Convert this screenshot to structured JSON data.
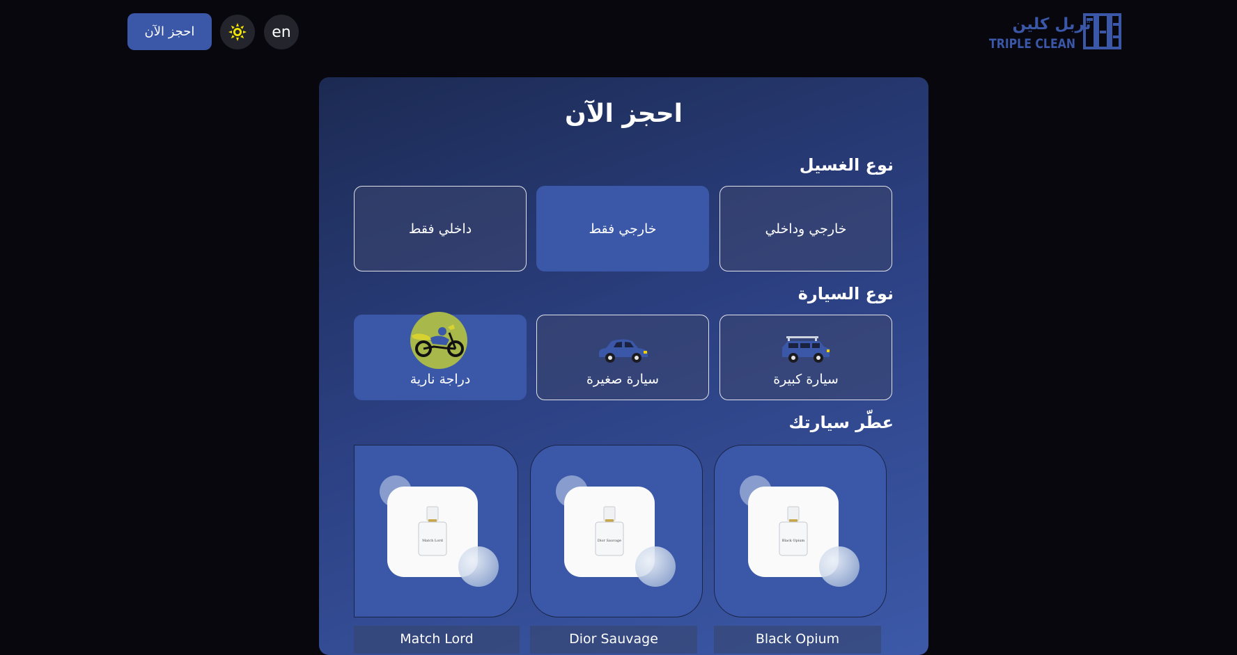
{
  "header": {
    "book_button": "احجز الآن",
    "theme_icon": "sun-icon",
    "language_button": "en",
    "logo": {
      "arabic_text": "تربل كلين",
      "latin_text": "TRIPLE CLEAN",
      "brand_color": "#3a57a8"
    }
  },
  "form": {
    "title": "احجز الآن",
    "wash_section": {
      "title": "نوع الغسيل",
      "options": [
        {
          "label": "خارجي وداخلي",
          "selected": false
        },
        {
          "label": "خارجي فقط",
          "selected": true
        },
        {
          "label": "داخلي فقط",
          "selected": false
        }
      ]
    },
    "vehicle_section": {
      "title": "نوع السيارة",
      "options": [
        {
          "label": "سيارة كبيرة",
          "icon": "suv-icon",
          "selected": false
        },
        {
          "label": "سيارة صغيرة",
          "icon": "small-car-icon",
          "selected": false
        },
        {
          "label": "دراجة نارية",
          "icon": "motorcycle-icon",
          "selected": true
        }
      ]
    },
    "perfume_section": {
      "title": "عطّر سيارتك",
      "items": [
        {
          "name": "Black Opium",
          "bottle_label": "Black Opium"
        },
        {
          "name": "Dior Sauvage",
          "bottle_label": "Dior Sauvage"
        },
        {
          "name": "Match Lord",
          "bottle_label": "Match Lord"
        }
      ]
    }
  },
  "colors": {
    "page_background": "#07070d",
    "accent": "#3a57a8",
    "control_background": "#24242c",
    "sun_icon": "#f5e600"
  }
}
